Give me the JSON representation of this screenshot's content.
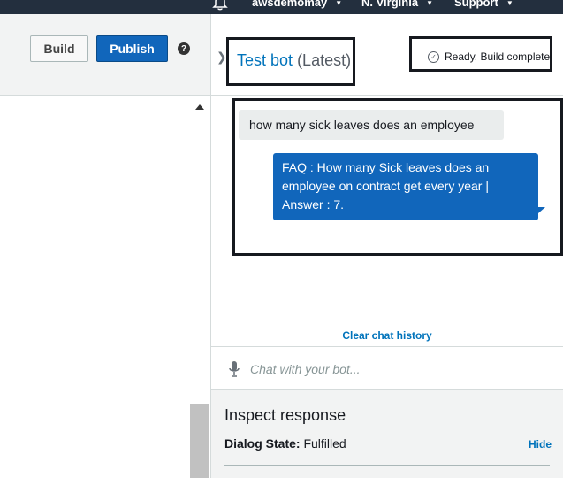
{
  "topnav": {
    "icon": "bell-icon",
    "account": "awsdemomay",
    "region": "N. Virginia",
    "support": "Support"
  },
  "toolbar": {
    "build_label": "Build",
    "publish_label": "Publish",
    "help_glyph": "?"
  },
  "test_bot": {
    "title": "Test bot",
    "version": "(Latest)",
    "status": "Ready. Build complete.",
    "messages": [
      {
        "from": "user",
        "text": "how many sick leaves does an employee"
      },
      {
        "from": "bot",
        "text": "FAQ : How many Sick leaves does an employee on contract get every year | Answer : 7."
      }
    ],
    "clear_history": "Clear chat history",
    "input_placeholder": "Chat with your bot..."
  },
  "inspect": {
    "title": "Inspect response",
    "dialog_state_label": "Dialog State:",
    "dialog_state_value": "Fulfilled",
    "hide_label": "Hide"
  },
  "colors": {
    "nav_bg": "#232f3e",
    "primary": "#1166bb",
    "link": "#0073bb",
    "panel_bg": "#f2f3f3"
  }
}
